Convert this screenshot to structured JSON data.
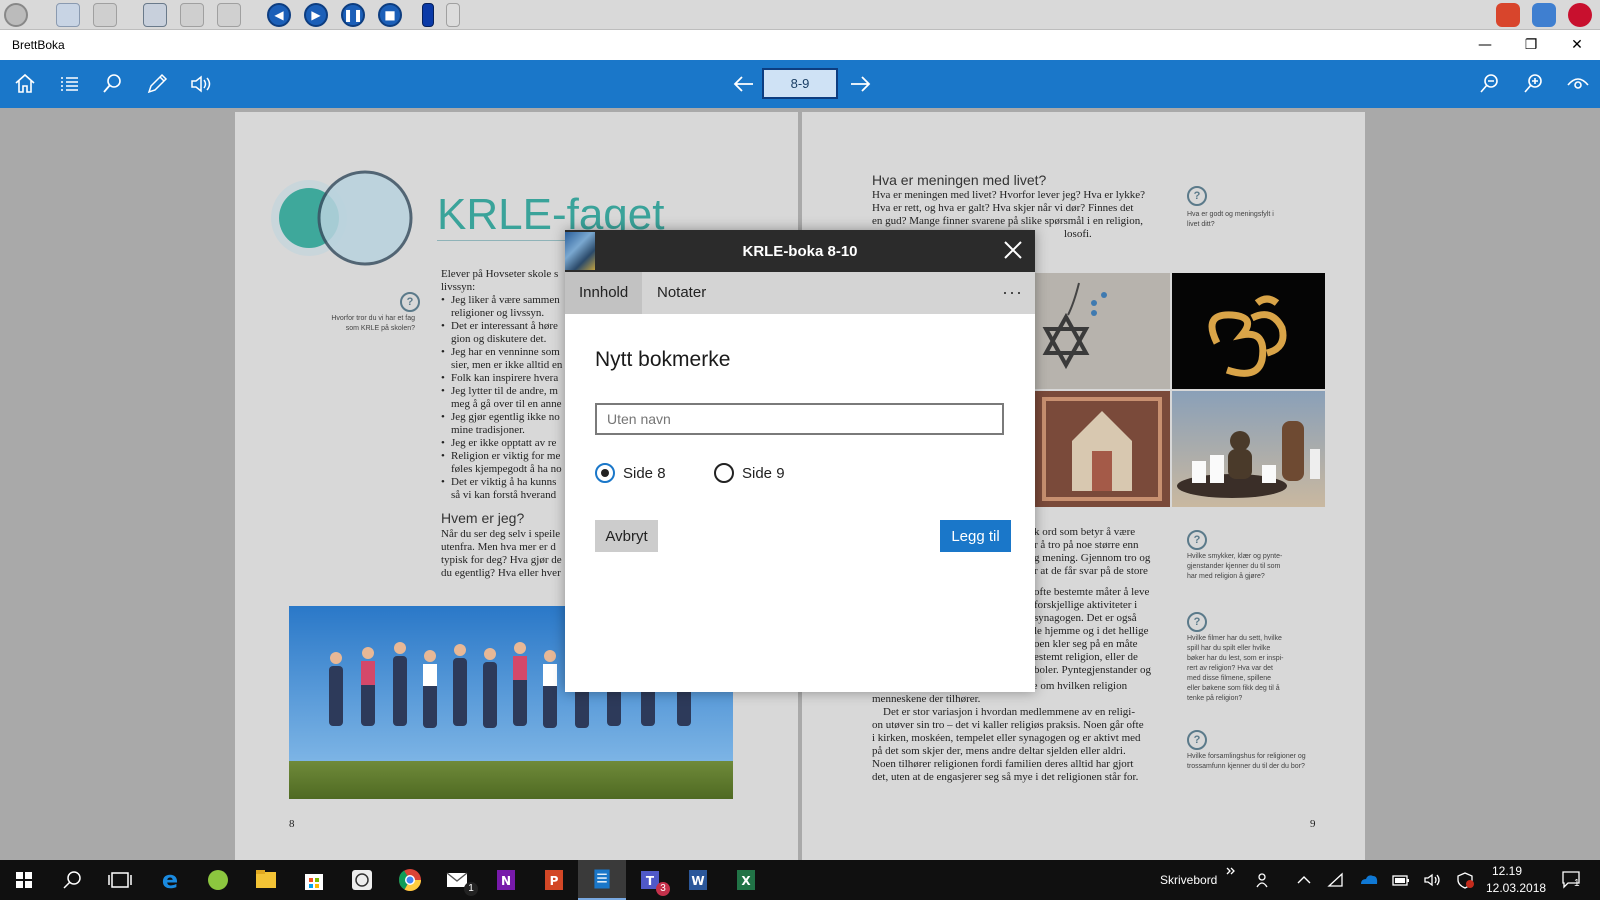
{
  "window": {
    "title": "BrettBoka",
    "minimize": "—",
    "restore": "❐",
    "close": "✕"
  },
  "toolbar": {
    "page_indicator": "8-9"
  },
  "book": {
    "left": {
      "heading": "KRLE-faget",
      "intro_lines": [
        "Elever på Hovseter skole s",
        "livssyn:"
      ],
      "bullets": [
        [
          "Jeg liker å være sammen",
          "religioner og livssyn."
        ],
        [
          "Det er interessant å høre",
          "gion og diskutere det."
        ],
        [
          "Jeg har en venninne som",
          "sier, men er ikke alltid en"
        ],
        [
          "Folk kan inspirere hvera"
        ],
        [
          "Jeg lytter til de andre, m",
          "meg å gå over til en anne"
        ],
        [
          "Jeg gjør egentlig ikke no",
          "mine tradisjoner."
        ],
        [
          "Jeg er ikke opptatt av re"
        ],
        [
          "Religion er viktig for me",
          "føles kjempegodt å ha no"
        ],
        [
          "Det er viktig å ha kunns",
          "så vi kan forstå hverand"
        ]
      ],
      "question_note": [
        "Hvorfor tror du vi har et fag",
        "som KRLE på skolen?"
      ],
      "subheading": "Hvem er jeg?",
      "sub_lines": [
        "Når du ser deg selv i speile",
        "utenfra. Men hva mer er d",
        "typisk for deg? Hva gjør de",
        "du egentlig? Hva eller hver"
      ],
      "page_number": "8"
    },
    "right": {
      "heading": "Hva er meningen med livet?",
      "lines": [
        "Hva er meningen med livet? Hvorfor lever jeg? Hva er lykke?",
        "Hva er rett, og hva er galt? Hva skjer når vi dør? Finnes det",
        "en gud? Mange finner svarene på slike spørsmål i en religion,",
        "losofi."
      ],
      "note1": [
        "Hva er godt og meningsfylt i",
        "livet ditt?"
      ],
      "mid_lines": [
        "k ord som betyr å være",
        "r å tro på noe større enn",
        "g mening. Gjennom tro og",
        "r at de får svar på de store"
      ],
      "mid_lines2": [
        "ofte bestemte måter å leve",
        "forskjellige aktiviteter i",
        "synagogen. Det er også",
        "le hjemme og i det hellige",
        "oen kler seg på en måte",
        "estemt religion, eller de",
        "boler. Pyntegjenstander og"
      ],
      "bottom_lines": [
        "kunst i hjemmet kan også fortelle noe om hvilken religion",
        "menneskene der tilhører.",
        " Det er stor variasjon i hvordan medlemmene av en religi-",
        "on utøver sin tro – det vi kaller religiøs praksis. Noen går ofte",
        "i kirken, moskéen, tempelet eller synagogen og er aktivt med",
        "på det som skjer der, mens andre deltar sjelden eller aldri.",
        "Noen tilhører religionen fordi familien deres alltid har gjort",
        "det, uten at de engasjerer seg så mye i det religionen står for."
      ],
      "note2": [
        "Hvilke smykker, klær og pynte-",
        "gjenstander kjenner du til som",
        "har med religion å gjøre?"
      ],
      "note3": [
        "Hvilke filmer har du sett, hvilke",
        "spill har du spilt eller hvilke",
        "bøker har du lest, som er inspi-",
        "rert av religion? Hva var det",
        "med disse filmene, spillene",
        "eller bøkene som fikk deg til å",
        "tenke på religion?"
      ],
      "note4": [
        "Hvilke forsamlingshus for religioner og",
        "trossamfunn kjenner du til der du bor?"
      ],
      "page_number": "9"
    },
    "question_mark": "?"
  },
  "dialog": {
    "title": "KRLE-boka 8-10",
    "tabs": [
      {
        "label": "Innhold",
        "active": true
      },
      {
        "label": "Notater",
        "active": false
      }
    ],
    "more_label": "···",
    "form_title": "Nytt bokmerke",
    "name_placeholder": "Uten navn",
    "options": [
      {
        "label": "Side 8",
        "checked": true
      },
      {
        "label": "Side 9",
        "checked": false
      }
    ],
    "cancel_label": "Avbryt",
    "add_label": "Legg til"
  },
  "taskbar": {
    "desktop_label": "Skrivebord",
    "time": "12.19",
    "date": "12.03.2018",
    "teams_badge": "3",
    "mail_badge": "1",
    "notification_count": "1"
  },
  "colors": {
    "accent": "#1a77c9",
    "dialog_header": "#2b2b2b",
    "heading_teal": "#3aa39a"
  }
}
